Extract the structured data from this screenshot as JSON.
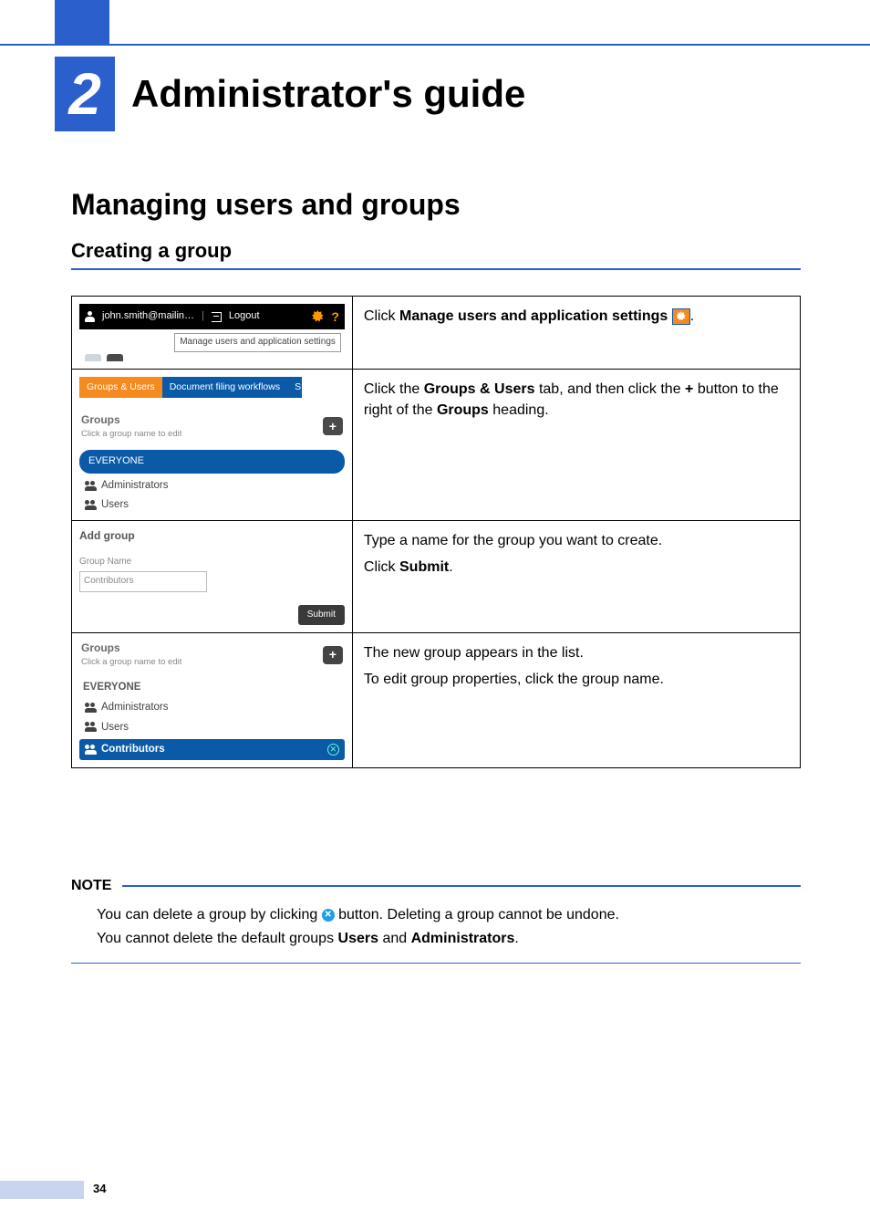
{
  "chapter": {
    "number": "2",
    "title": "Administrator's guide"
  },
  "h1": "Managing users and groups",
  "h2": "Creating a group",
  "step1": {
    "user": "john.smith@mailin…",
    "logout": "Logout",
    "tooltip": "Manage users and application settings",
    "instr_pre": "Click ",
    "instr_bold": "Manage users and application settings",
    "instr_post": "."
  },
  "step2": {
    "tab_active": "Groups & Users",
    "tab_other": "Document filing workflows",
    "tab_stub": "S",
    "groups_label": "Groups",
    "groups_sub": "Click a group name to edit",
    "pill": "EVERYONE",
    "item_admins": "Administrators",
    "item_users": "Users",
    "instr_a": "Click the ",
    "instr_b": "Groups & Users",
    "instr_c": " tab, and then click the ",
    "instr_d": "+",
    "instr_e": " button to the right of the ",
    "instr_f": "Groups",
    "instr_g": " heading."
  },
  "step3": {
    "panel_title": "Add group",
    "field_label": "Group Name",
    "field_value": "Contributors",
    "submit": "Submit",
    "instr_line1": "Type a name for the group you want to create.",
    "instr_line2a": "Click ",
    "instr_line2b": "Submit",
    "instr_line2c": "."
  },
  "step4": {
    "groups_label": "Groups",
    "groups_sub": "Click a group name to edit",
    "pill": "EVERYONE",
    "item_admins": "Administrators",
    "item_users": "Users",
    "item_contrib": "Contributors",
    "instr_line1": "The new group appears in the list.",
    "instr_line2": "To edit group properties, click the group name."
  },
  "note": {
    "label": "NOTE",
    "line1a": "You can delete a group by clicking ",
    "line1b": " button. Deleting a group cannot be undone.",
    "line2a": "You cannot delete the default groups ",
    "line2b": "Users",
    "line2c": " and ",
    "line2d": "Administrators",
    "line2e": "."
  },
  "page_number": "34"
}
